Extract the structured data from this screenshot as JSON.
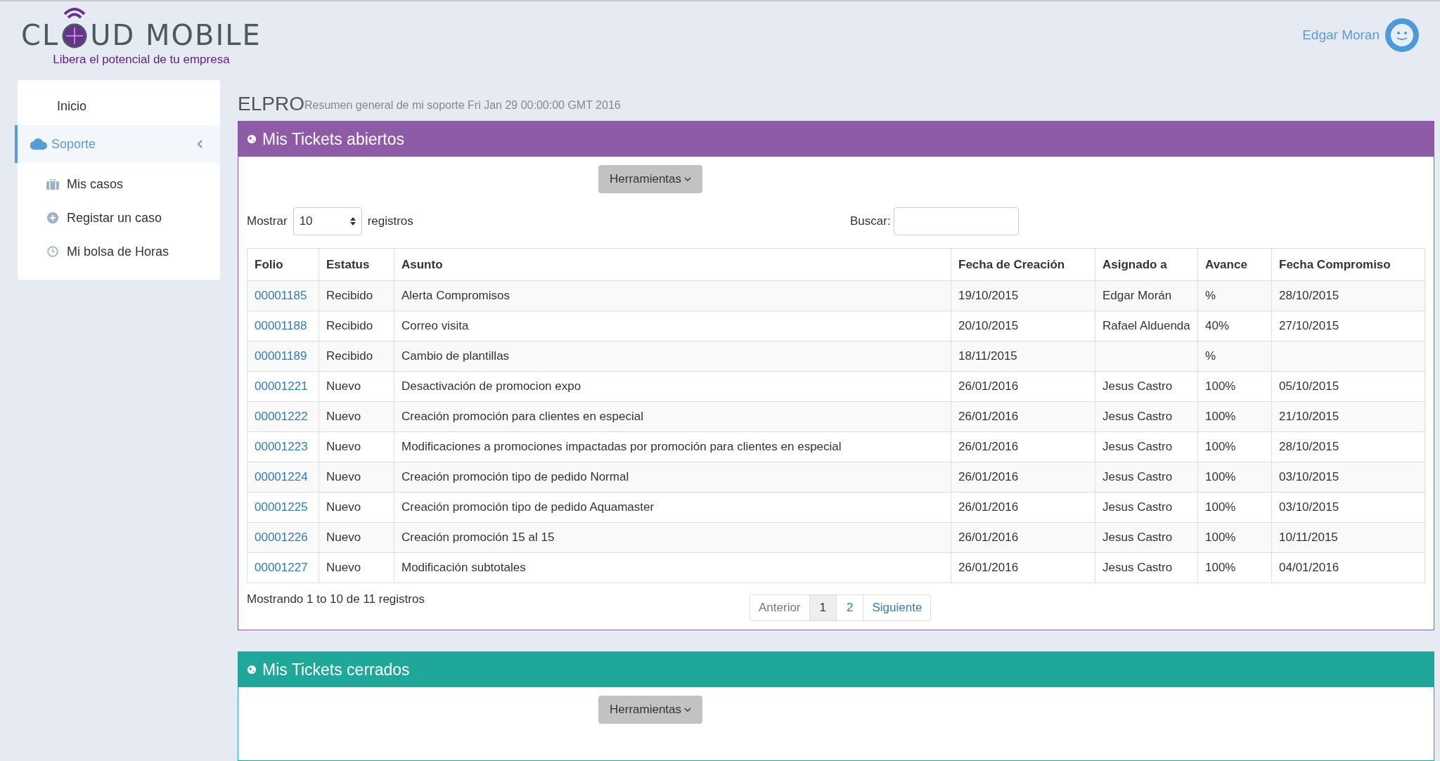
{
  "header": {
    "logo": {
      "text_before": "CL",
      "text_after": "UD MOBILE",
      "tagline": "Libera el potencial de tu empresa"
    },
    "user": {
      "name": "Edgar Moran"
    }
  },
  "sidebar": {
    "items": [
      {
        "label": "Inicio",
        "selected": false
      },
      {
        "label": "Soporte",
        "selected": true,
        "expanded": true,
        "children": [
          {
            "label": "Mis casos",
            "selected": false
          },
          {
            "label": "Registar un caso",
            "selected": false
          },
          {
            "label": "Mi bolsa de Horas",
            "selected": false
          }
        ]
      }
    ]
  },
  "page": {
    "title": "ELPRO",
    "subtitle": "Resumen general de mi soporte Fri Jan 29 00:00:00 GMT 2016"
  },
  "panels": [
    {
      "title": "Mis Tickets abiertos",
      "color": "#8e5ba6",
      "tools_button": "Herramientas",
      "length": {
        "label_before": "Mostrar",
        "value": "10",
        "label_after": "registros"
      },
      "search": {
        "label": "Buscar:"
      },
      "table": {
        "columns": [
          "Folio",
          "Estatus",
          "Asunto",
          "Fecha de Creación",
          "Asignado a",
          "Avance",
          "Fecha Compromiso"
        ],
        "rows": [
          [
            "00001185",
            "Recibido",
            "Alerta Compromisos",
            "19/10/2015",
            "Edgar Morán",
            "%",
            "28/10/2015"
          ],
          [
            "00001188",
            "Recibido",
            "Correo visita",
            "20/10/2015",
            "Rafael Alduenda",
            "40%",
            "27/10/2015"
          ],
          [
            "00001189",
            "Recibido",
            "Cambio de plantillas",
            "18/11/2015",
            "",
            "%",
            ""
          ],
          [
            "00001221",
            "Nuevo",
            "Desactivación de promocion expo",
            "26/01/2016",
            "Jesus Castro",
            "100%",
            "05/10/2015"
          ],
          [
            "00001222",
            "Nuevo",
            "Creación promoción para clientes en especial",
            "26/01/2016",
            "Jesus Castro",
            "100%",
            "21/10/2015"
          ],
          [
            "00001223",
            "Nuevo",
            "Modificaciones a promociones impactadas por promoción para clientes en especial",
            "26/01/2016",
            "Jesus Castro",
            "100%",
            "28/10/2015"
          ],
          [
            "00001224",
            "Nuevo",
            "Creación promoción tipo de pedido Normal",
            "26/01/2016",
            "Jesus Castro",
            "100%",
            "03/10/2015"
          ],
          [
            "00001225",
            "Nuevo",
            "Creación promoción tipo de pedido Aquamaster",
            "26/01/2016",
            "Jesus Castro",
            "100%",
            "03/10/2015"
          ],
          [
            "00001226",
            "Nuevo",
            "Creación promoción 15 al 15",
            "26/01/2016",
            "Jesus Castro",
            "100%",
            "10/11/2015"
          ],
          [
            "00001227",
            "Nuevo",
            "Modificación subtotales",
            "26/01/2016",
            "Jesus Castro",
            "100%",
            "04/01/2016"
          ]
        ]
      },
      "info": "Mostrando 1 to 10 de 11 registros",
      "pagination": {
        "previous": {
          "label": "Anterior",
          "disabled": true
        },
        "pages": [
          {
            "label": "1",
            "selected": true
          },
          {
            "label": "2",
            "selected": false
          }
        ],
        "next": {
          "label": "Siguiente",
          "disabled": false
        }
      }
    },
    {
      "title": "Mis Tickets cerrados",
      "color": "#1fa899",
      "tools_button": "Herramientas"
    }
  ]
}
